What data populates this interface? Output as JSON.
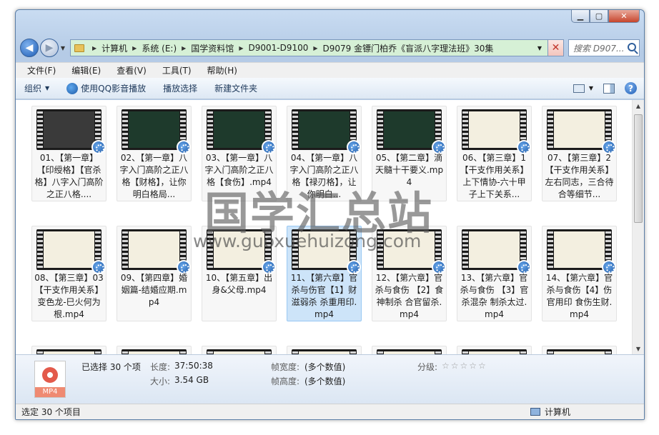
{
  "window": {
    "caption_buttons": [
      "minimize",
      "maximize",
      "close"
    ]
  },
  "address": {
    "crumbs": [
      "计算机",
      "系统 (E:)",
      "国学资料馆",
      "D9001-D9100",
      "D9079 金镖门柏乔《盲派八字理法班》30集"
    ],
    "search_placeholder": "搜索 D907..."
  },
  "menu": [
    "文件(F)",
    "编辑(E)",
    "查看(V)",
    "工具(T)",
    "帮助(H)"
  ],
  "toolbar": {
    "organize": "组织",
    "play_qq": "使用QQ影音播放",
    "play_selection": "播放选择",
    "new_folder": "新建文件夹"
  },
  "files": [
    {
      "name": "01、【第一章】【印绶格】【官杀格】八字入门高阶之正八格....",
      "thumb": "#3a3a3a"
    },
    {
      "name": "02、【第一章】八字入门高阶之正八格【财格】，让你明白格局...",
      "thumb": "#1e3a2c"
    },
    {
      "name": "03、【第一章】八字入门高阶之正八格【食伤】.mp4",
      "thumb": "#1e3a2c"
    },
    {
      "name": "04、【第一章】八字入门高阶之正八格【禄刃格】，让你明白...",
      "thumb": "#1e3a2c"
    },
    {
      "name": "05、【第二章】滴天髓十干要义.mp4",
      "thumb": "#1e3a2c"
    },
    {
      "name": "06、【第三章】1【干支作用关系】上下情协-六十甲子上下关系...",
      "thumb": "#f3efe0"
    },
    {
      "name": "07、【第三章】2【干支作用关系】左右同志，三合待合等细节...",
      "thumb": "#f3efe0"
    },
    {
      "name": "08、【第三章】03【干支作用关系】变色龙-巳火何为根.mp4",
      "thumb": "#f3efe0"
    },
    {
      "name": "09、【第四章】婚姻篇-结婚应期.mp4",
      "thumb": "#f3efe0"
    },
    {
      "name": "10、【第五章】出身&父母.mp4",
      "thumb": "#f3efe0"
    },
    {
      "name": "11、【第六章】官杀与伤官【1】财滋弱杀 杀重用印.mp4",
      "thumb": "#f3efe0"
    },
    {
      "name": "12、【第六章】官杀与食伤 【2】食神制杀 合官留杀.mp4",
      "thumb": "#f3efe0"
    },
    {
      "name": "13、【第六章】官杀与食伤 【3】官杀混杂 制杀太过.mp4",
      "thumb": "#f3efe0"
    },
    {
      "name": "14、【第六章】官杀与食伤【4】伤官用印 食伤生财.mp4",
      "thumb": "#f3efe0"
    },
    {
      "name": "",
      "thumb": "#f3efe0"
    },
    {
      "name": "",
      "thumb": "#f3efe0"
    },
    {
      "name": "",
      "thumb": "#f3efe0"
    },
    {
      "name": "",
      "thumb": "#f3efe0"
    },
    {
      "name": "",
      "thumb": "#f3efe0"
    },
    {
      "name": "",
      "thumb": "#f3efe0"
    },
    {
      "name": "",
      "thumb": "#f3efe0"
    }
  ],
  "details": {
    "icon_label": "MP4",
    "selected": "已选择 30 个项",
    "length_label": "长度:",
    "length": "37:50:38",
    "size_label": "大小:",
    "size": "3.54 GB",
    "frame_width_label": "帧宽度:",
    "frame_width": "(多个数值)",
    "frame_height_label": "帧高度:",
    "frame_height": "(多个数值)",
    "rating_label": "分级:",
    "rating": "☆☆☆☆☆"
  },
  "status": {
    "left": "选定 30 个项目",
    "right": "计算机"
  },
  "watermark": {
    "title": "国学汇总站",
    "url": "www.guoxuehuizong.com"
  }
}
